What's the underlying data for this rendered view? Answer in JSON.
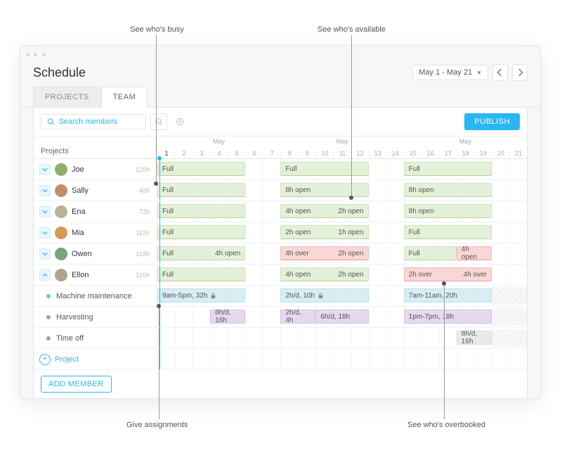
{
  "callouts": {
    "busy": "See who's busy",
    "available": "See who's available",
    "assign": "Give assignments",
    "overbooked": "See who's overbooked"
  },
  "header": {
    "title": "Schedule",
    "dateRange": "May 1 - May 21"
  },
  "tabs": {
    "projects": "PROJECTS",
    "team": "TEAM"
  },
  "toolbar": {
    "searchPlaceholder": "Search members",
    "publish": "PUBLISH"
  },
  "gridHeader": {
    "leftLabel": "Projects",
    "monthLabel": "May"
  },
  "days": [
    "1",
    "2",
    "3",
    "4",
    "5",
    "6",
    "7",
    "8",
    "9",
    "10",
    "11",
    "12",
    "13",
    "14",
    "15",
    "16",
    "17",
    "18",
    "19",
    "20",
    "21"
  ],
  "members": [
    {
      "name": "Joe",
      "hours": "120h",
      "avatarColor": "#8fae6a",
      "weeks": [
        {
          "color": "green",
          "labels": [
            "Full"
          ]
        },
        {
          "color": "green",
          "labels": [
            "Full"
          ]
        },
        {
          "color": "green",
          "labels": [
            "Full"
          ]
        }
      ]
    },
    {
      "name": "Sally",
      "hours": "40h",
      "avatarColor": "#c48c6e",
      "weeks": [
        {
          "color": "green",
          "labels": [
            "Full"
          ]
        },
        {
          "color": "green",
          "labels": [
            "8h open"
          ]
        },
        {
          "color": "green",
          "labels": [
            "8h open"
          ]
        }
      ]
    },
    {
      "name": "Ena",
      "hours": "72h",
      "avatarColor": "#b7b49a",
      "weeks": [
        {
          "color": "green",
          "labels": [
            "Full"
          ]
        },
        {
          "color": "green",
          "labels": [
            "4h open",
            "2h open"
          ]
        },
        {
          "color": "green",
          "labels": [
            "8h open"
          ]
        }
      ]
    },
    {
      "name": "Mia",
      "hours": "112h",
      "avatarColor": "#d69a54",
      "weeks": [
        {
          "color": "green",
          "labels": [
            "Full"
          ]
        },
        {
          "color": "green",
          "labels": [
            "2h open",
            "1h open"
          ]
        },
        {
          "color": "green",
          "labels": [
            "Full"
          ]
        }
      ]
    },
    {
      "name": "Owen",
      "hours": "118h",
      "avatarColor": "#7da07d",
      "weeks": [
        {
          "color": "green",
          "labels": [
            "Full",
            "4h open"
          ]
        },
        {
          "color": "red",
          "labels": [
            "4h over",
            "2h open"
          ]
        },
        {
          "color": "mixed",
          "labels": [
            "Full",
            "4h open"
          ]
        }
      ]
    },
    {
      "name": "Ellon",
      "hours": "120h",
      "avatarColor": "#b0a28f",
      "expanded": true,
      "weeks": [
        {
          "color": "green",
          "labels": [
            "Full"
          ]
        },
        {
          "color": "green",
          "labels": [
            "4h open",
            "2h open"
          ]
        },
        {
          "color": "red",
          "labels": [
            "2h over",
            "4h over"
          ]
        }
      ]
    }
  ],
  "projects": [
    {
      "name": "Machine maintenance",
      "bullet": "#67c8d6",
      "bars": [
        {
          "week": 0,
          "start": 0,
          "span": 5,
          "color": "cyan",
          "label": "9am-5pm, 32h",
          "locked": true
        },
        {
          "week": 1,
          "start": 0,
          "span": 5,
          "color": "cyan",
          "label": "2h/d, 10h",
          "locked": true
        },
        {
          "week": 2,
          "start": 0,
          "span": 5,
          "color": "cyan",
          "label": "7am-11am, 20h"
        }
      ]
    },
    {
      "name": "Harvesting",
      "bullet": "#b38fd1",
      "bars": [
        {
          "week": 0,
          "start": 3,
          "span": 2,
          "color": "purple",
          "label": "8h/d, 16h"
        },
        {
          "week": 1,
          "start": 0,
          "span": 2,
          "color": "purple",
          "label": "2h/d, 4h"
        },
        {
          "week": 1,
          "start": 2,
          "span": 3,
          "color": "purple",
          "label": "6h/d, 18h"
        },
        {
          "week": 2,
          "start": 0,
          "span": 5,
          "color": "purple",
          "label": "1pm-7pm, 18h"
        }
      ]
    },
    {
      "name": "Time off",
      "bullet": "#9aa0a6",
      "bars": [
        {
          "week": 2,
          "start": 3,
          "span": 2,
          "color": "gray",
          "label": "8h/d, 16h"
        }
      ]
    }
  ],
  "addProjectLabel": "Project",
  "addMemberLabel": "ADD MEMBER"
}
